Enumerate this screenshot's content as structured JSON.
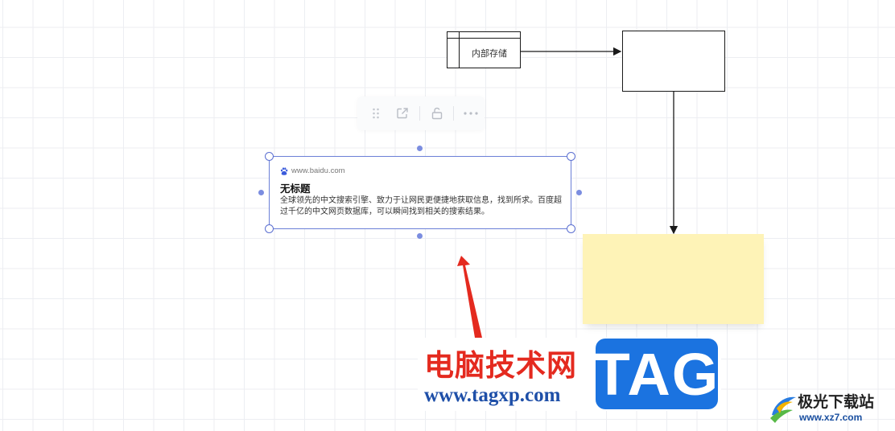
{
  "diagram": {
    "storage_label": "内部存储"
  },
  "toolbar": {
    "items": [
      {
        "icon": "drag-handle-icon"
      },
      {
        "icon": "open-external-icon"
      },
      {
        "icon": "unlock-icon"
      },
      {
        "icon": "more-icon"
      }
    ]
  },
  "link_card": {
    "url": "www.baidu.com",
    "title": "无标题",
    "description": "全球领先的中文搜索引擎、致力于让网民更便捷地获取信息，找到所求。百度超过千亿的中文网页数据库，可以瞬间找到相关的搜索结果。"
  },
  "watermark": {
    "cn_text": "电脑技术网",
    "url": "www.tagxp.com",
    "tag": "TAG",
    "brand_name": "极光下载站",
    "brand_url": "www.xz7.com"
  },
  "colors": {
    "selection": "#6b7fd7",
    "sticky_note": "#fef3b7",
    "arrow_red": "#e42a1f",
    "tag_blue": "#1b73e0"
  }
}
